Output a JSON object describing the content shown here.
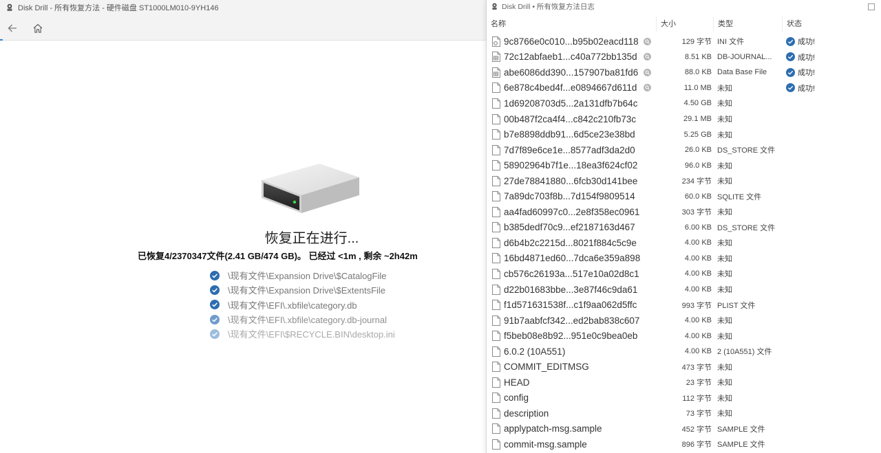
{
  "left": {
    "title": "Disk Drill - 所有恢复方法 - 硬件磁盘 ST1000LM010-9YH146",
    "heading": "恢复正在进行...",
    "status_line": "已恢复4/2370347文件(2.41 GB/474 GB)。 已经过 <1m , 剩余 ~2h42m",
    "recovered_files": [
      "\\现有文件\\Expansion Drive\\$CatalogFile",
      "\\现有文件\\Expansion Drive\\$ExtentsFile",
      "\\现有文件\\EFI\\.xbfile\\category.db",
      "\\现有文件\\EFI\\.xbfile\\category.db-journal",
      "\\现有文件\\EFI\\$RECYCLE.BIN\\desktop.ini"
    ]
  },
  "right": {
    "title": "Disk Drill • 所有恢复方法日志",
    "columns": {
      "name": "名称",
      "size": "大小",
      "type": "类型",
      "status": "状态"
    },
    "rows": [
      {
        "name": "9c8766e0c010...b95b02eacd118",
        "size": "129 字节",
        "type": "INI 文件",
        "status": "成功!",
        "icon": "ini"
      },
      {
        "name": "72c12abfaeb1...c40a772bb135d",
        "size": "8.51 KB",
        "type": "DB-JOURNAL...",
        "status": "成功!",
        "icon": "db"
      },
      {
        "name": "abe6086dd390...157907ba81fd6",
        "size": "88.0 KB",
        "type": "Data Base File",
        "status": "成功!",
        "icon": "db"
      },
      {
        "name": "6e878c4bed4f...e0894667d611d",
        "size": "11.0 MB",
        "type": "未知",
        "status": "成功!",
        "icon": "file"
      },
      {
        "name": "1d69208703d5...2a131dfb7b64c",
        "size": "4.50 GB",
        "type": "未知",
        "status": "",
        "icon": "file"
      },
      {
        "name": "00b487f2ca4f4...c842c210fb73c",
        "size": "29.1 MB",
        "type": "未知",
        "status": "",
        "icon": "file"
      },
      {
        "name": "b7e8898ddb91...6d5ce23e38bd",
        "size": "5.25 GB",
        "type": "未知",
        "status": "",
        "icon": "file"
      },
      {
        "name": "7d7f89e6ce1e...8577adf3da2d0",
        "size": "26.0 KB",
        "type": "DS_STORE 文件",
        "status": "",
        "icon": "file"
      },
      {
        "name": "58902964b7f1e...18ea3f624cf02",
        "size": "96.0 KB",
        "type": "未知",
        "status": "",
        "icon": "file"
      },
      {
        "name": "27de78841880...6fcb30d141bee",
        "size": "234 字节",
        "type": "未知",
        "status": "",
        "icon": "file"
      },
      {
        "name": "7a89dc703f8b...7d154f9809514",
        "size": "60.0 KB",
        "type": "SQLITE 文件",
        "status": "",
        "icon": "file"
      },
      {
        "name": "aa4fad60997c0...2e8f358ec0961",
        "size": "303 字节",
        "type": "未知",
        "status": "",
        "icon": "file"
      },
      {
        "name": "b385dedf70c9...ef2187163d467",
        "size": "6.00 KB",
        "type": "DS_STORE 文件",
        "status": "",
        "icon": "file"
      },
      {
        "name": "d6b4b2c2215d...8021f884c5c9e",
        "size": "4.00 KB",
        "type": "未知",
        "status": "",
        "icon": "file"
      },
      {
        "name": "16bd4871ed60...7dca6e359a898",
        "size": "4.00 KB",
        "type": "未知",
        "status": "",
        "icon": "file"
      },
      {
        "name": "cb576c26193a...517e10a02d8c1",
        "size": "4.00 KB",
        "type": "未知",
        "status": "",
        "icon": "file"
      },
      {
        "name": "d22b01683bbe...3e87f46c9da61",
        "size": "4.00 KB",
        "type": "未知",
        "status": "",
        "icon": "file"
      },
      {
        "name": "f1d571631538f...c1f9aa062d5ffc",
        "size": "993 字节",
        "type": "PLIST 文件",
        "status": "",
        "icon": "file"
      },
      {
        "name": "91b7aabfcf342...ed2bab838c607",
        "size": "4.00 KB",
        "type": "未知",
        "status": "",
        "icon": "file"
      },
      {
        "name": "f5beb08e8b92...951e0c9bea0eb",
        "size": "4.00 KB",
        "type": "未知",
        "status": "",
        "icon": "file"
      },
      {
        "name": "6.0.2 (10A551)",
        "size": "4.00 KB",
        "type": "2 (10A551) 文件",
        "status": "",
        "icon": "file"
      },
      {
        "name": "COMMIT_EDITMSG",
        "size": "473 字节",
        "type": "未知",
        "status": "",
        "icon": "file"
      },
      {
        "name": "HEAD",
        "size": "23 字节",
        "type": "未知",
        "status": "",
        "icon": "file"
      },
      {
        "name": "config",
        "size": "112 字节",
        "type": "未知",
        "status": "",
        "icon": "file"
      },
      {
        "name": "description",
        "size": "73 字节",
        "type": "未知",
        "status": "",
        "icon": "file"
      },
      {
        "name": "applypatch-msg.sample",
        "size": "452 字节",
        "type": "SAMPLE 文件",
        "status": "",
        "icon": "file"
      },
      {
        "name": "commit-msg.sample",
        "size": "896 字节",
        "type": "SAMPLE 文件",
        "status": "",
        "icon": "file"
      }
    ]
  },
  "colors": {
    "accent": "#2f6db5",
    "success": "#2d6db0",
    "faded_check": "#8bb0d6"
  }
}
